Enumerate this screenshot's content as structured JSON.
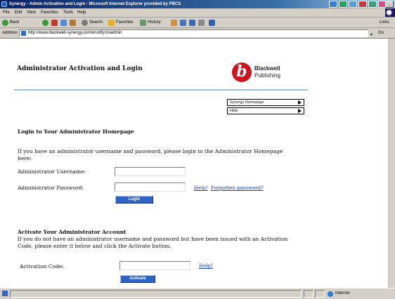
{
  "window": {
    "title": "Synergy - Admin Activation and Login - Microsoft Internet Explorer provided by PBCS",
    "controls": [
      "_",
      "□",
      "×"
    ]
  },
  "menubar": {
    "items": [
      "File",
      "Edit",
      "View",
      "Favorites",
      "Tools",
      "Help"
    ]
  },
  "toolbar": {
    "back": "Back",
    "search": "Search",
    "favorites": "Favorites",
    "history": "History",
    "links": "Links"
  },
  "addressbar": {
    "label": "Address",
    "url": "http://www.blackwell-synergy.com/enotify/onadmin",
    "go": "Go"
  },
  "page": {
    "title": "Administrator Activation and Login",
    "logo": {
      "mark": "b",
      "line1": "Blackwell",
      "line2": "Publishing"
    },
    "nav": {
      "homepage": "Synergy Homepage",
      "help": "Help"
    },
    "login": {
      "heading": "Login to Your Administrator Homepage",
      "intro": "If you have an administrator username and password, please login to the Administrator Homepage here:",
      "username_label": "Administrator Username:",
      "password_label": "Administrator Password:",
      "help_link": "Help!",
      "forgot_link": "Forgotten password?",
      "button": "Login"
    },
    "activate": {
      "heading": "Activate Your Administrator Account",
      "intro": "If you do not have an administrator username and password but have been issued with an Activation Code, please enter it below and click the Activate button.",
      "code_label": "Activation Code:",
      "help_link": "Help!",
      "button": "Activate"
    }
  },
  "statusbar": {
    "zone": "Internet"
  },
  "colors": {
    "title_bar": "#0a246a",
    "chrome": "#d4d0c8",
    "accent_rule": "#9fc3e7",
    "button_blue": "#2f63c6",
    "link": "#1a3fb8",
    "logo_red": "#d0121b"
  }
}
